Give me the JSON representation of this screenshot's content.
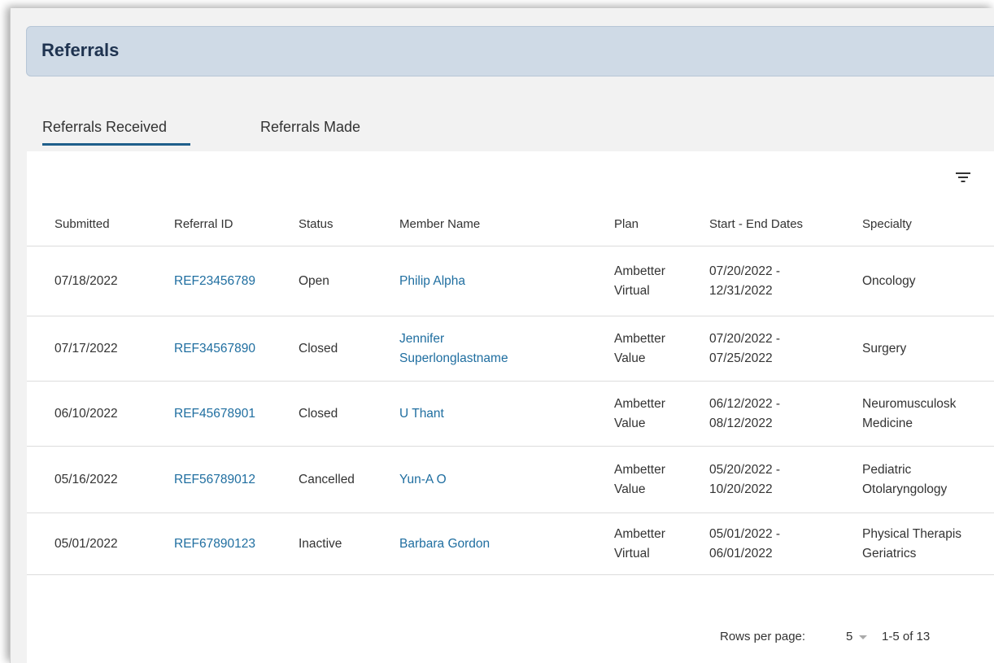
{
  "page": {
    "title": "Referrals"
  },
  "tabs": [
    {
      "label": "Referrals Received",
      "active": true
    },
    {
      "label": "Referrals Made",
      "active": false
    }
  ],
  "table": {
    "columns": [
      "Submitted",
      "Referral ID",
      "Status",
      "Member Name",
      "Plan",
      "Start - End Dates",
      "Specialty"
    ],
    "rows": [
      {
        "submitted": "07/18/2022",
        "referral_id": "REF23456789",
        "status": "Open",
        "member": [
          "Philip Alpha"
        ],
        "plan": [
          "Ambetter",
          "Virtual"
        ],
        "dates": [
          "07/20/2022 -",
          "12/31/2022"
        ],
        "specialty": [
          "Oncology"
        ]
      },
      {
        "submitted": "07/17/2022",
        "referral_id": "REF34567890",
        "status": "Closed",
        "member": [
          "Jennifer",
          "Superlonglastname"
        ],
        "plan": [
          "Ambetter",
          "Value"
        ],
        "dates": [
          "07/20/2022 -",
          "07/25/2022"
        ],
        "specialty": [
          "Surgery"
        ]
      },
      {
        "submitted": "06/10/2022",
        "referral_id": "REF45678901",
        "status": "Closed",
        "member": [
          "U Thant"
        ],
        "plan": [
          "Ambetter",
          "Value"
        ],
        "dates": [
          "06/12/2022 -",
          "08/12/2022"
        ],
        "specialty": [
          "Neuromusculosk",
          "Medicine"
        ]
      },
      {
        "submitted": "05/16/2022",
        "referral_id": "REF56789012",
        "status": "Cancelled",
        "member": [
          "Yun-A O"
        ],
        "plan": [
          "Ambetter",
          "Value"
        ],
        "dates": [
          "05/20/2022 -",
          "10/20/2022"
        ],
        "specialty": [
          "Pediatric",
          "Otolaryngology"
        ]
      },
      {
        "submitted": "05/01/2022",
        "referral_id": "REF67890123",
        "status": "Inactive",
        "member": [
          "Barbara Gordon"
        ],
        "plan": [
          "Ambetter",
          "Virtual"
        ],
        "dates": [
          "05/01/2022 -",
          "06/01/2022"
        ],
        "specialty": [
          "Physical Therapis",
          "Geriatrics"
        ]
      }
    ]
  },
  "pagination": {
    "rows_per_page_label": "Rows per page:",
    "rows_per_page_value": "5",
    "range": "1-5 of 13"
  },
  "icons": {
    "filter": "filter-icon",
    "dropdown": "chevron-down-icon"
  },
  "colors": {
    "header_bg": "#cfdae6",
    "link": "#1f6ea0",
    "tab_underline": "#1f5f8b"
  }
}
